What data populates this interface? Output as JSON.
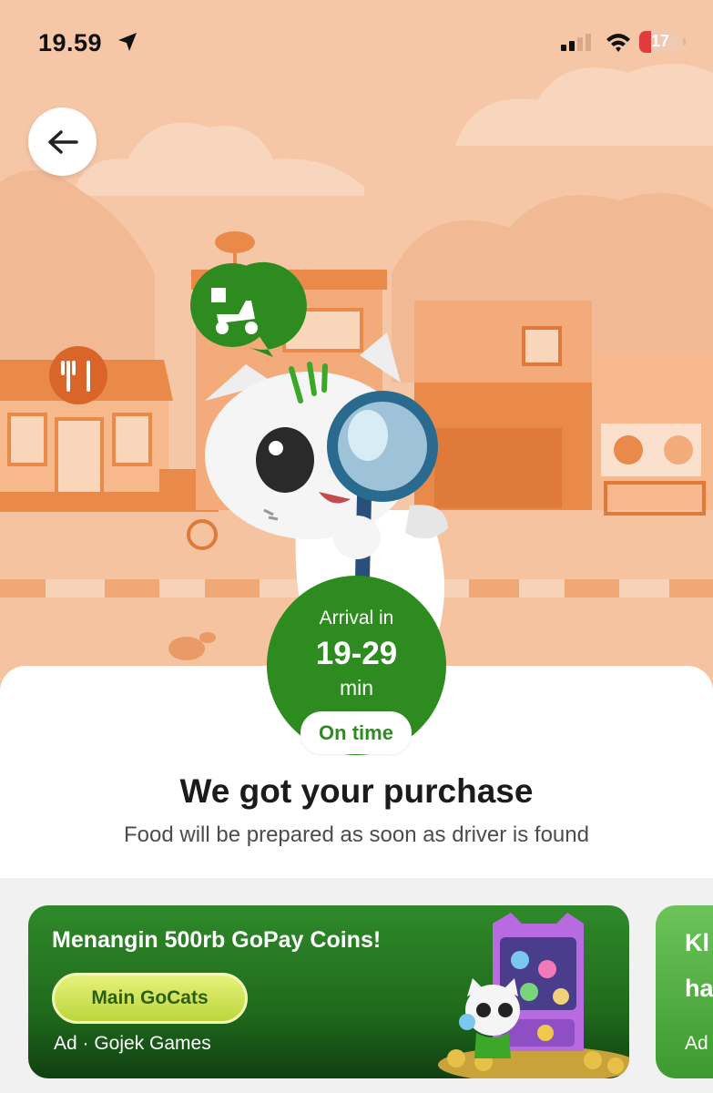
{
  "status_bar": {
    "time": "19.59",
    "battery_level": "17"
  },
  "arrival": {
    "label": "Arrival in",
    "range": "19-29",
    "unit": "min",
    "status": "On time"
  },
  "order": {
    "headline": "We got your purchase",
    "subline": "Food will be prepared as soon as driver is found"
  },
  "ads": [
    {
      "title": "Menangin 500rb GoPay Coins!",
      "cta": "Main GoCats",
      "meta": "Ad · Gojek Games"
    },
    {
      "title_line1": "Kl",
      "title_line2": "ha",
      "meta": "Ad"
    }
  ],
  "colors": {
    "brand_green": "#2e8b1f",
    "hero_bg": "#f6c7a6",
    "accent_orange": "#e98a4a"
  },
  "icons": [
    "location-arrow-icon",
    "signal-icon",
    "wifi-icon",
    "back-arrow-icon",
    "fork-knife-icon",
    "delivery-scooter-icon",
    "magnifier-icon"
  ]
}
